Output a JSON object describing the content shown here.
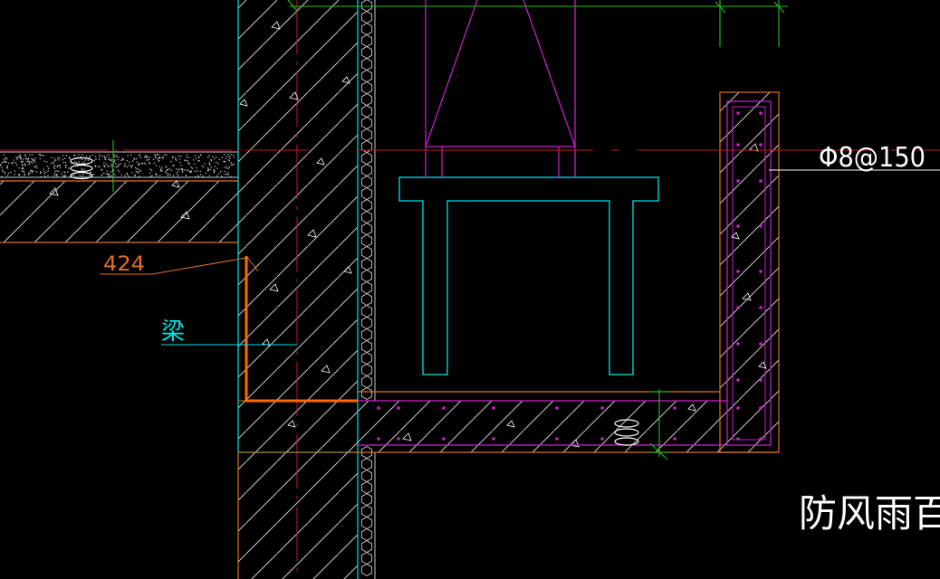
{
  "drawing": {
    "background": "#000000",
    "colors": {
      "cyan": "#00e5e5",
      "magenta": "#d020d0",
      "orange": "#e07020",
      "orange_bright": "#ff6a00",
      "red_line": "#c81818",
      "green": "#20c020",
      "white": "#ffffff",
      "hatch": "#c8c8c8"
    }
  },
  "annotations": {
    "dimension_424": "424",
    "beam_label": "梁",
    "rebar_spec": "Φ8@150",
    "louver_label": "防风雨百叶"
  }
}
